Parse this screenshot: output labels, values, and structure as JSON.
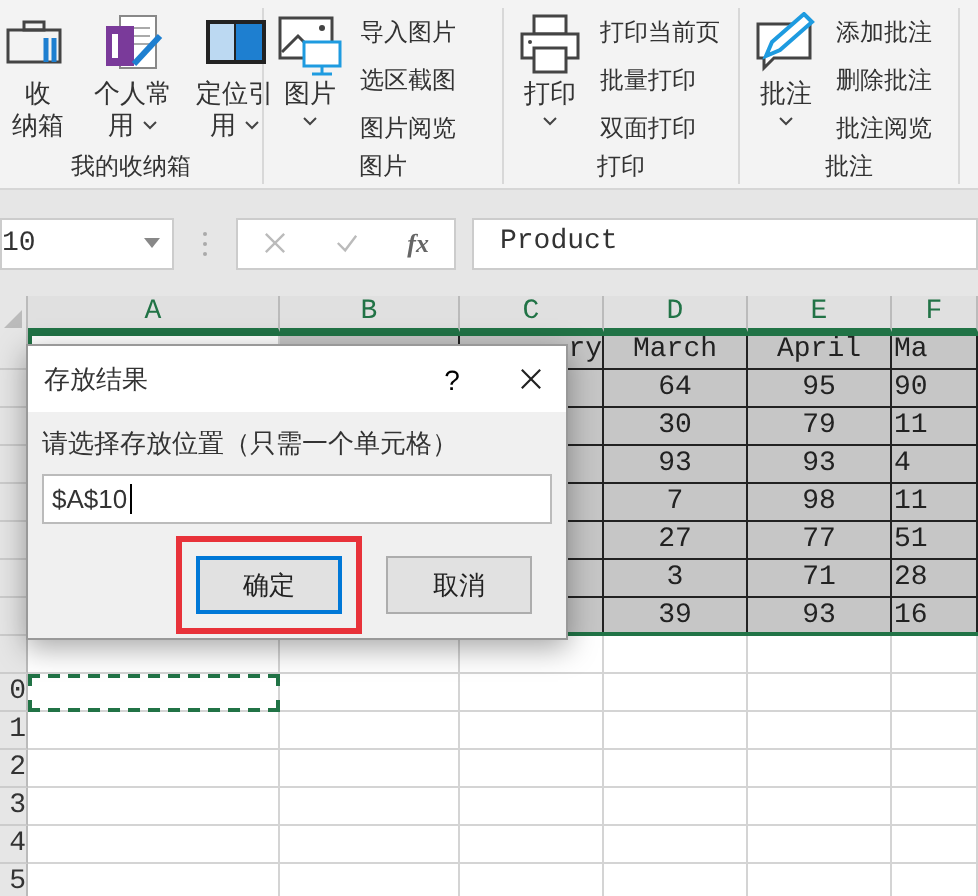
{
  "ribbon": {
    "groups": [
      {
        "label": "我的收纳箱",
        "large_buttons": [
          {
            "kind": "toolbox",
            "lines": [
              "收",
              "纳箱"
            ],
            "dropdown": false
          },
          {
            "kind": "notebook",
            "lines": [
              "个人常",
              "用"
            ],
            "dropdown": true
          },
          {
            "kind": "panel",
            "lines": [
              "定位引",
              "用"
            ],
            "dropdown": true
          }
        ]
      },
      {
        "label": "图片",
        "large_buttons": [
          {
            "kind": "picture",
            "lines": [
              "图片"
            ],
            "dropdown": true
          }
        ],
        "small_buttons": [
          "导入图片",
          "选区截图",
          "图片阅览"
        ]
      },
      {
        "label": "打印",
        "large_buttons": [
          {
            "kind": "printer",
            "lines": [
              "打印"
            ],
            "dropdown": true
          }
        ],
        "small_buttons": [
          "打印当前页",
          "批量打印",
          "双面打印"
        ]
      },
      {
        "label": "批注",
        "large_buttons": [
          {
            "kind": "pen",
            "lines": [
              "批注"
            ],
            "dropdown": true
          }
        ],
        "small_buttons": [
          "添加批注",
          "删除批注",
          "批注阅览"
        ]
      }
    ]
  },
  "formula_bar": {
    "name_box": "10",
    "function_label": "fx",
    "formula": "Product"
  },
  "sheet": {
    "columns": [
      "A",
      "B",
      "C",
      "D",
      "E",
      "F"
    ],
    "rows": [
      {
        "selected": true,
        "marquee": false,
        "cells": {
          "C": "ry",
          "D": "March",
          "E": "April",
          "F": "Ma"
        }
      },
      {
        "selected": true,
        "marquee": false,
        "cells": {
          "D": "64",
          "E": "95",
          "F": "90"
        }
      },
      {
        "selected": true,
        "marquee": false,
        "cells": {
          "D": "30",
          "E": "79",
          "F": "11"
        }
      },
      {
        "selected": true,
        "marquee": false,
        "cells": {
          "D": "93",
          "E": "93",
          "F": "4"
        }
      },
      {
        "selected": true,
        "marquee": false,
        "cells": {
          "D": "7",
          "E": "98",
          "F": "11"
        }
      },
      {
        "selected": true,
        "marquee": false,
        "cells": {
          "D": "27",
          "E": "77",
          "F": "51"
        }
      },
      {
        "selected": true,
        "marquee": false,
        "cells": {
          "D": "3",
          "E": "71",
          "F": "28"
        }
      },
      {
        "selected": true,
        "marquee": false,
        "cells": {
          "D": "39",
          "E": "93",
          "F": "16"
        }
      },
      {
        "selected": false,
        "marquee": false,
        "cells": {}
      },
      {
        "number": "0",
        "selected": false,
        "marquee": true,
        "cells": {}
      },
      {
        "number": "1",
        "selected": false,
        "marquee": false,
        "cells": {}
      },
      {
        "number": "2",
        "selected": false,
        "marquee": false,
        "cells": {}
      },
      {
        "number": "3",
        "selected": false,
        "marquee": false,
        "cells": {}
      },
      {
        "number": "4",
        "selected": false,
        "marquee": false,
        "cells": {}
      },
      {
        "number": "5",
        "selected": false,
        "marquee": false,
        "cells": {}
      }
    ]
  },
  "dialog": {
    "title": "存放结果",
    "help": "?",
    "prompt": "请选择存放位置（只需一个单元格）",
    "value": "$A$10",
    "buttons": [
      {
        "label": "确定",
        "focused": true,
        "highlighted": true
      },
      {
        "label": "取消",
        "focused": false,
        "highlighted": false
      }
    ]
  }
}
